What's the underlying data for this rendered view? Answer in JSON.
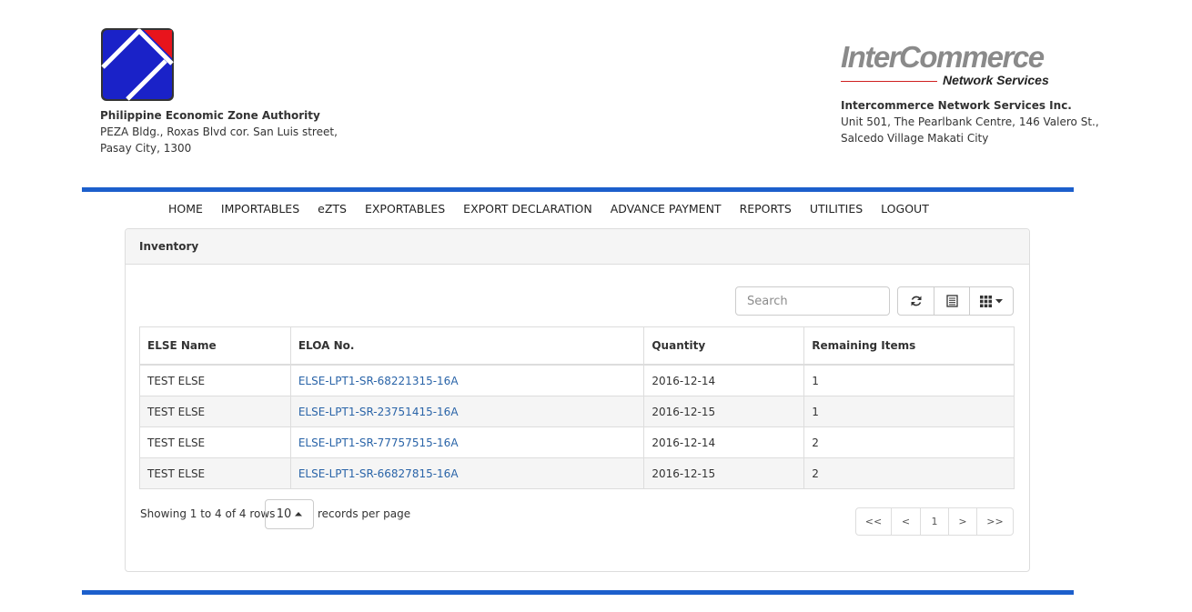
{
  "header": {
    "left": {
      "org_name": "Philippine Economic Zone Authority",
      "address_line1": "PEZA Bldg., Roxas Blvd cor. San Luis street,",
      "address_line2": "Pasay City, 1300",
      "logo_icon": "peza-logo-icon",
      "logo_colors": {
        "blue": "#1a22c8",
        "red": "#e8141c"
      }
    },
    "right": {
      "logo_text": "InterCommerce",
      "logo_subtext": "Network Services",
      "company_name": "Intercommerce Network Services Inc.",
      "address_line1": "Unit 501, The Pearlbank Centre, 146 Valero St.,",
      "address_line2": "Salcedo Village Makati City"
    }
  },
  "colors": {
    "accent_rule": "#1c5fcc",
    "link": "#2a64a8"
  },
  "nav": {
    "items": [
      "HOME",
      "IMPORTABLES",
      "eZTS",
      "EXPORTABLES",
      "EXPORT DECLARATION",
      "ADVANCE PAYMENT",
      "REPORTS",
      "UTILITIES",
      "LOGOUT"
    ]
  },
  "panel": {
    "title": "Inventory"
  },
  "toolbar": {
    "search_placeholder": "Search",
    "refresh_icon": "refresh-icon",
    "toggle_view_icon": "list-view-icon",
    "columns_icon": "columns-grid-icon"
  },
  "table": {
    "columns": [
      "ELSE Name",
      "ELOA No.",
      "Quantity",
      "Remaining Items"
    ],
    "rows": [
      [
        "TEST ELSE",
        "ELSE-LPT1-SR-68221315-16A",
        "2016-12-14",
        "1"
      ],
      [
        "TEST ELSE",
        "ELSE-LPT1-SR-23751415-16A",
        "2016-12-15",
        "1"
      ],
      [
        "TEST ELSE",
        "ELSE-LPT1-SR-77757515-16A",
        "2016-12-14",
        "2"
      ],
      [
        "TEST ELSE",
        "ELSE-LPT1-SR-66827815-16A",
        "2016-12-15",
        "2"
      ]
    ]
  },
  "footer": {
    "showing_text": "Showing 1 to 4 of 4 rows",
    "page_size": "10",
    "per_page_text": "records per page",
    "pager": [
      "<<",
      "<",
      "1",
      ">",
      ">>"
    ]
  }
}
